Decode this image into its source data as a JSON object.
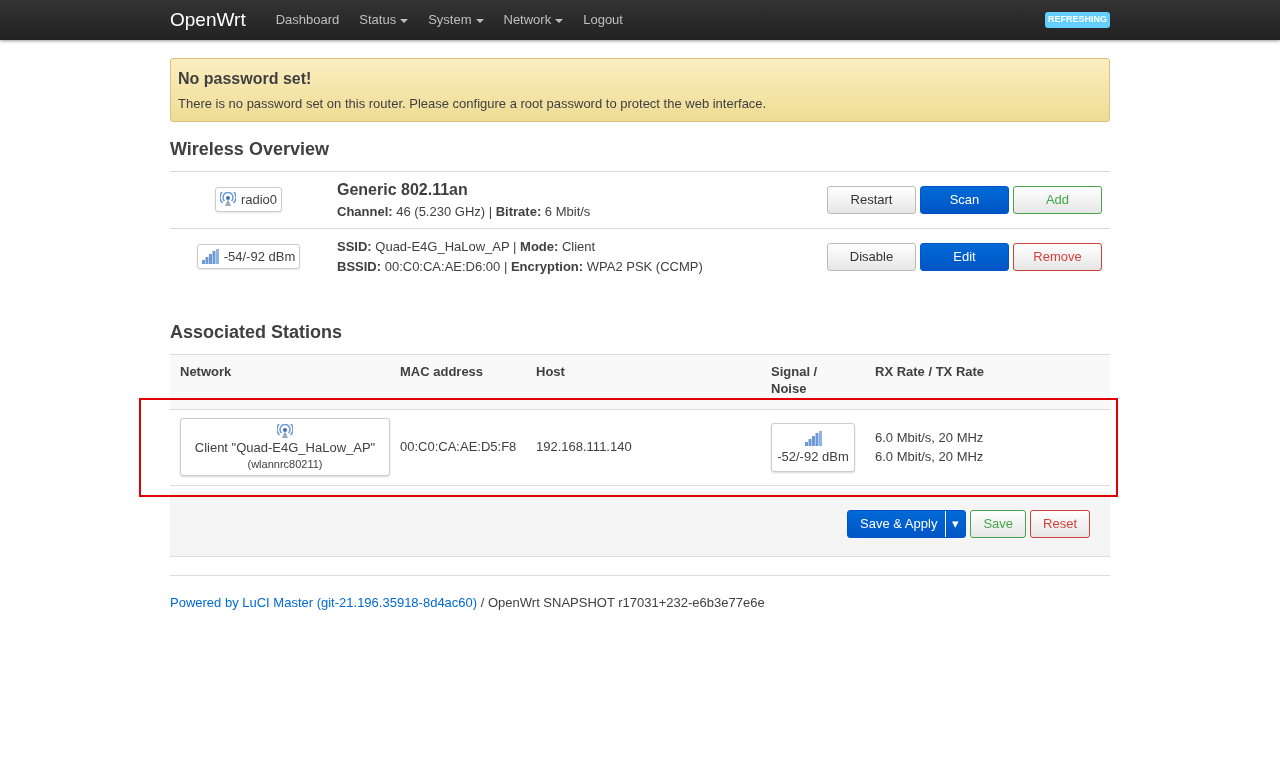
{
  "navbar": {
    "brand": "OpenWrt",
    "items": [
      {
        "label": "Dashboard",
        "dropdown": false
      },
      {
        "label": "Status",
        "dropdown": true
      },
      {
        "label": "System",
        "dropdown": true
      },
      {
        "label": "Network",
        "dropdown": true
      },
      {
        "label": "Logout",
        "dropdown": false
      }
    ],
    "indicator": "REFRESHING"
  },
  "alert": {
    "title": "No password set!",
    "text": "There is no password set on this router. Please configure a root password to protect the web interface."
  },
  "wireless_overview": {
    "title": "Wireless Overview",
    "rows": [
      {
        "kind": "radio",
        "badge": "radio0",
        "heading": "Generic 802.11an",
        "lines": [
          "**Channel:** 46 (5.230 GHz) | **Bitrate:** 6 Mbit/s"
        ],
        "buttons": [
          {
            "label": "Restart",
            "kind": "default"
          },
          {
            "label": "Scan",
            "kind": "primary"
          },
          {
            "label": "Add",
            "kind": "positive"
          }
        ]
      },
      {
        "kind": "signal",
        "badge": "-54/-92 dBm",
        "lines": [
          "**SSID:** Quad-E4G_HaLow_AP | **Mode:** Client",
          "**BSSID:** 00:C0:CA:AE:D6:00 | **Encryption:** WPA2 PSK (CCMP)"
        ],
        "buttons": [
          {
            "label": "Disable",
            "kind": "default"
          },
          {
            "label": "Edit",
            "kind": "primary"
          },
          {
            "label": "Remove",
            "kind": "negative"
          }
        ]
      }
    ]
  },
  "associated_stations": {
    "title": "Associated Stations",
    "columns": [
      "Network",
      "MAC address",
      "Host",
      "Signal / Noise",
      "RX Rate / TX Rate"
    ],
    "rows": [
      {
        "network": "Client \"Quad-E4G_HaLow_AP\"",
        "interface": "(wlannrc80211)",
        "mac": "00:C0:CA:AE:D5:F8",
        "host": "192.168.111.140",
        "signal": "-52/-92 dBm",
        "rates": [
          "6.0 Mbit/s, 20 MHz",
          "6.0 Mbit/s, 20 MHz"
        ],
        "highlighted": true
      }
    ]
  },
  "actions": [
    {
      "label": "Save & Apply",
      "kind": "primary",
      "dropdown": true,
      "dropdown_glyph": "▾"
    },
    {
      "label": "Save",
      "kind": "positive",
      "dropdown": false
    },
    {
      "label": "Reset",
      "kind": "negative",
      "dropdown": false
    }
  ],
  "footer": {
    "link": "Powered by LuCI Master (git-21.196.35918-8d4ac60)",
    "text": "/ OpenWrt SNAPSHOT r17031+232-e6b3e77e6e"
  }
}
